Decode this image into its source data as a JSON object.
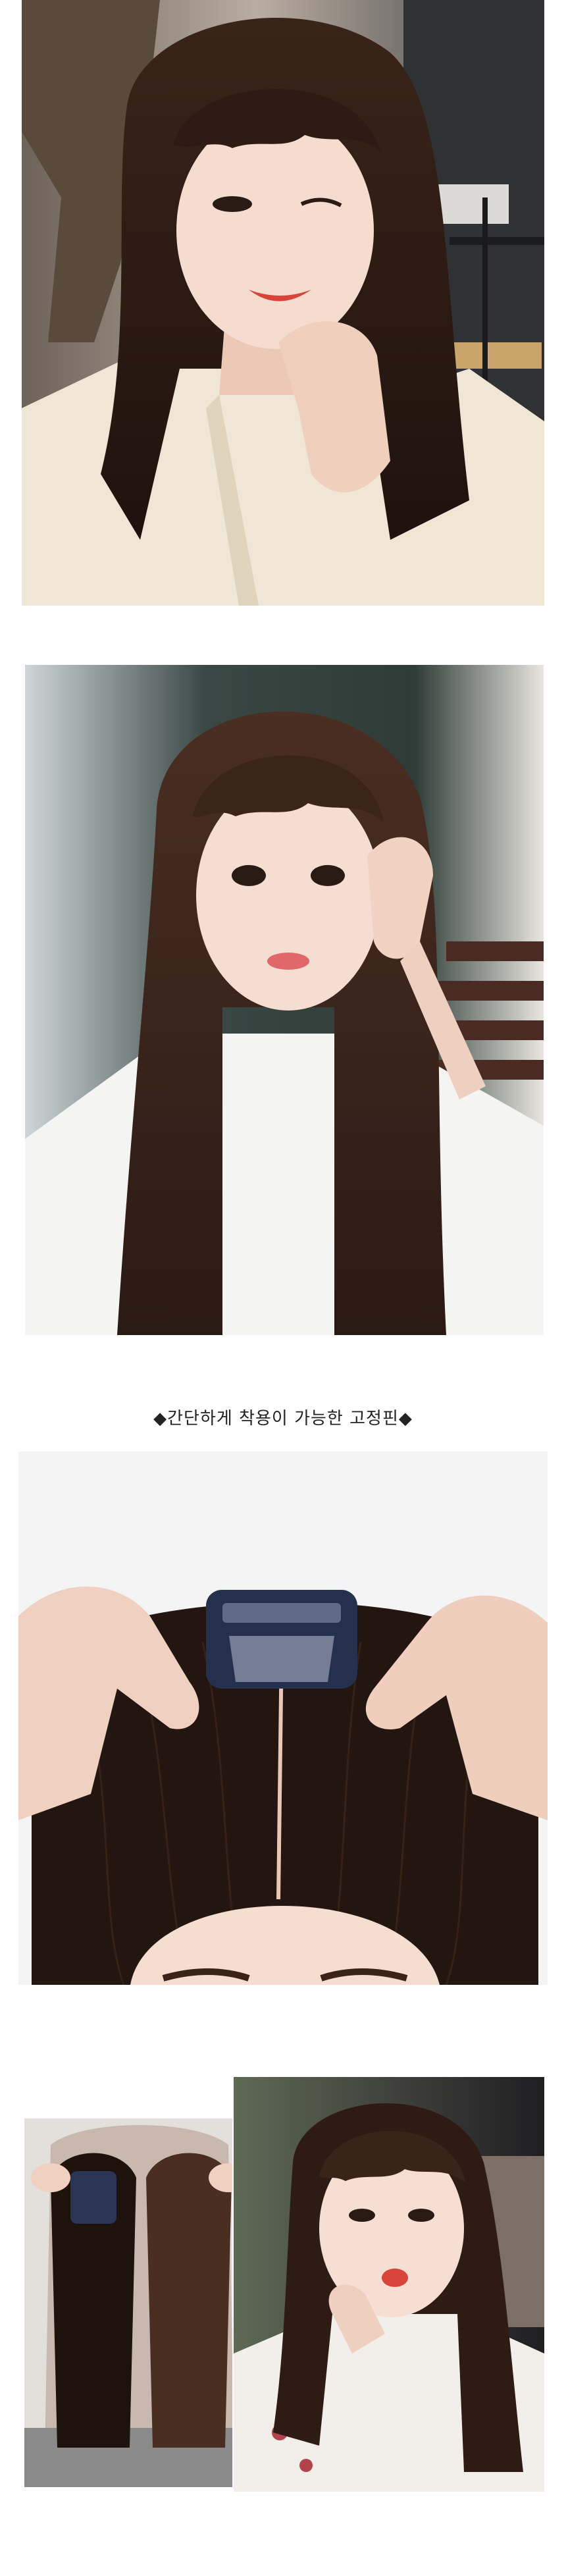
{
  "caption": "◆간단하게 착용이 가능한 고정핀◆",
  "images": [
    {
      "name": "model-selfie-wink",
      "kind": "photo"
    },
    {
      "name": "model-long-hair-pose",
      "kind": "photo"
    },
    {
      "name": "hair-topper-clip-closeup",
      "kind": "photo"
    },
    {
      "name": "hair-topper-products",
      "kind": "photo"
    },
    {
      "name": "model-bangs-pout",
      "kind": "photo"
    }
  ],
  "colors": {
    "hair_dark": "#2a1a14",
    "hair_brown": "#4a2e22",
    "skin": "#f3d8cb",
    "lip_red": "#d8433a",
    "shirt_cream": "#efe6d6",
    "shirt_white": "#f4f4f2",
    "clip_navy": "#25304f"
  }
}
